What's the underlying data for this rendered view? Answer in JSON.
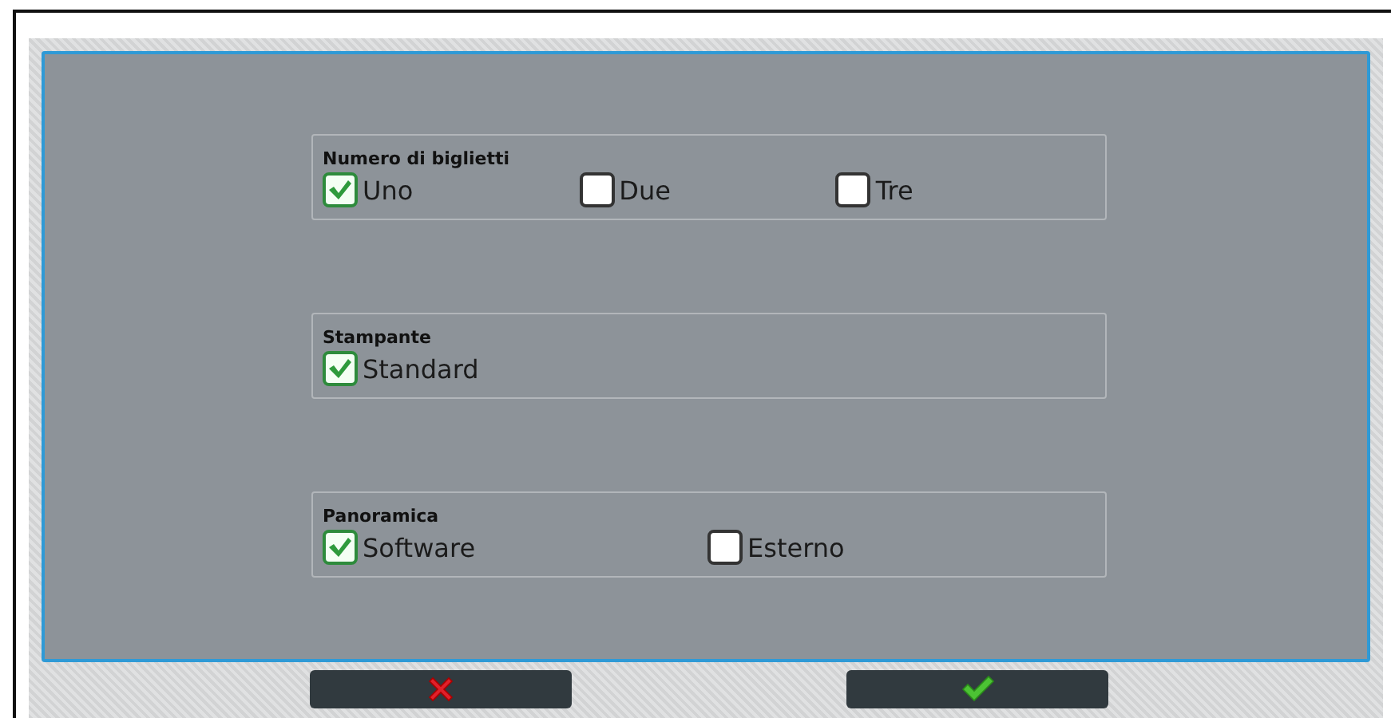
{
  "groups": [
    {
      "title": "Numero di biglietti",
      "options": [
        {
          "label": "Uno",
          "checked": true
        },
        {
          "label": "Due",
          "checked": false
        },
        {
          "label": "Tre",
          "checked": false
        }
      ]
    },
    {
      "title": "Stampante",
      "options": [
        {
          "label": "Standard",
          "checked": true
        }
      ]
    },
    {
      "title": "Panoramica",
      "options": [
        {
          "label": "Software",
          "checked": true
        },
        {
          "label": "Esterno",
          "checked": false
        }
      ]
    }
  ],
  "buttons": [
    {
      "kind": "cancel"
    },
    {
      "kind": "confirm"
    }
  ]
}
